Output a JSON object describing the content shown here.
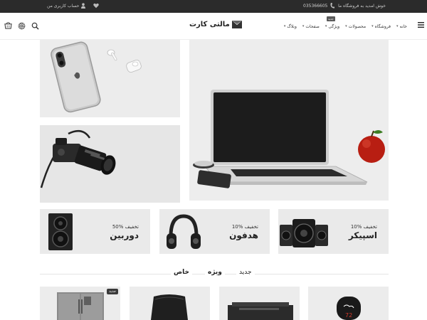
{
  "topbar": {
    "welcome": "خوش امدید به فروشگاه ما",
    "phone": "035366605",
    "account": "حساب کاربری من"
  },
  "header": {
    "logo_text": "مالتی کارت",
    "nav": [
      {
        "label": "خانه"
      },
      {
        "label": "فروشگاه"
      },
      {
        "label": "محصولات"
      },
      {
        "label": "ویژگی",
        "badge": "جدید"
      },
      {
        "label": "صفحات"
      },
      {
        "label": "وبلاگ"
      }
    ]
  },
  "promos": [
    {
      "discount": "50% تخفیف",
      "name": "دوربین"
    },
    {
      "discount": "10% تخفیف",
      "name": "هدفون"
    },
    {
      "discount": "10% تخفیف",
      "name": "اسپیکر"
    }
  ],
  "tabs": {
    "new": "جدید",
    "special": "ویژه",
    "exclusive": "خاص"
  },
  "products": {
    "badge_new": "جدید"
  },
  "icons": [
    "menu-icon",
    "search-icon",
    "settings-icon",
    "cart-icon",
    "heart-icon",
    "user-icon",
    "phone-icon"
  ]
}
